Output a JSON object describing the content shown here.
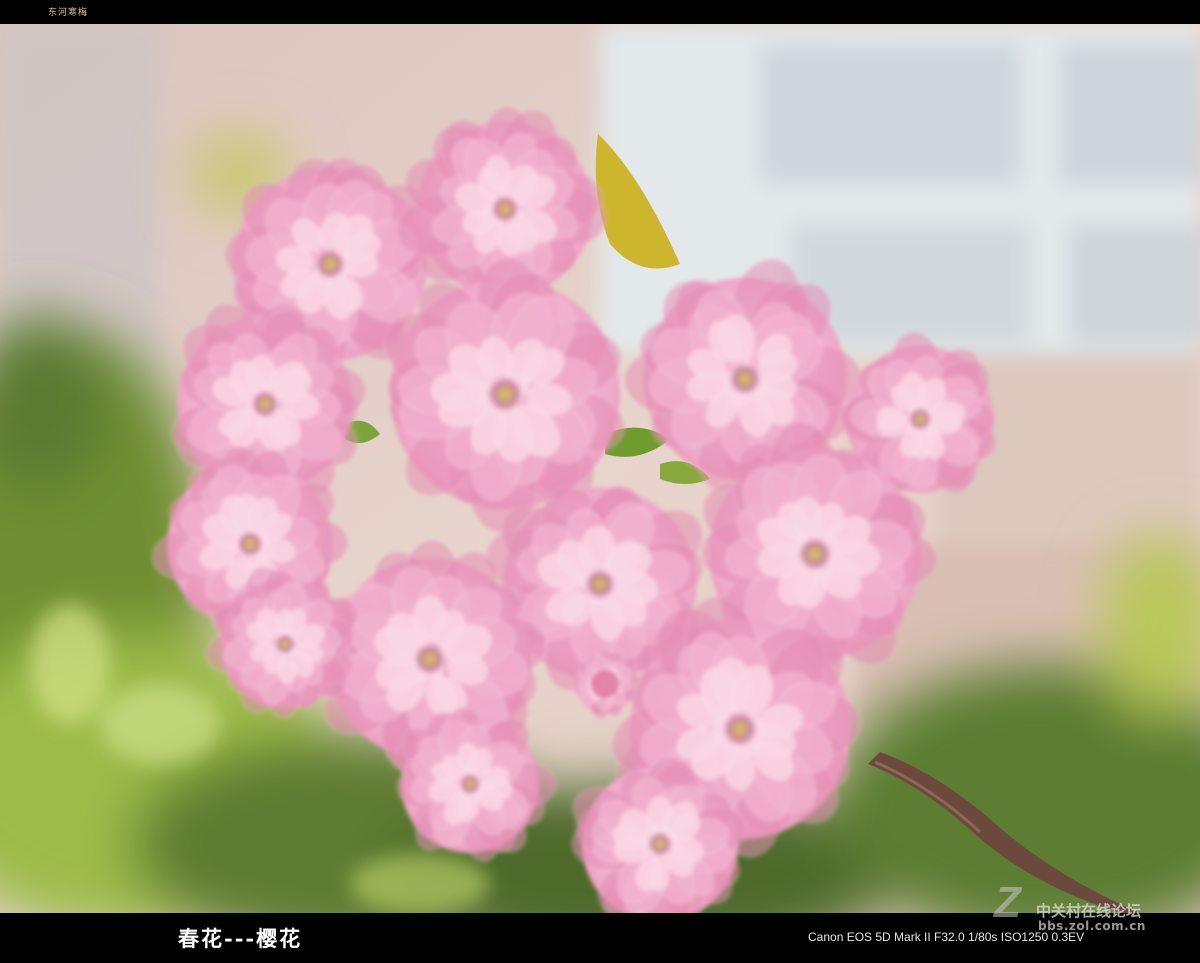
{
  "header": {
    "author": "东河寒梅"
  },
  "caption": {
    "title": "春花---樱花",
    "exif": "Canon EOS 5D Mark II F32.0 1/80s ISO1250 0.3EV"
  },
  "watermark": {
    "brand": "中关村在线论坛",
    "url": "bbs.zol.com.cn"
  },
  "photo": {
    "subject": "cherry-blossom-cluster",
    "colors": {
      "petal": "#f3b3cf",
      "petal_light": "#fbd6e5",
      "petal_deep": "#e58fb4",
      "foliage": "#8fae3e",
      "wall": "#e8d6cf",
      "window": "#dfe6ea"
    }
  }
}
